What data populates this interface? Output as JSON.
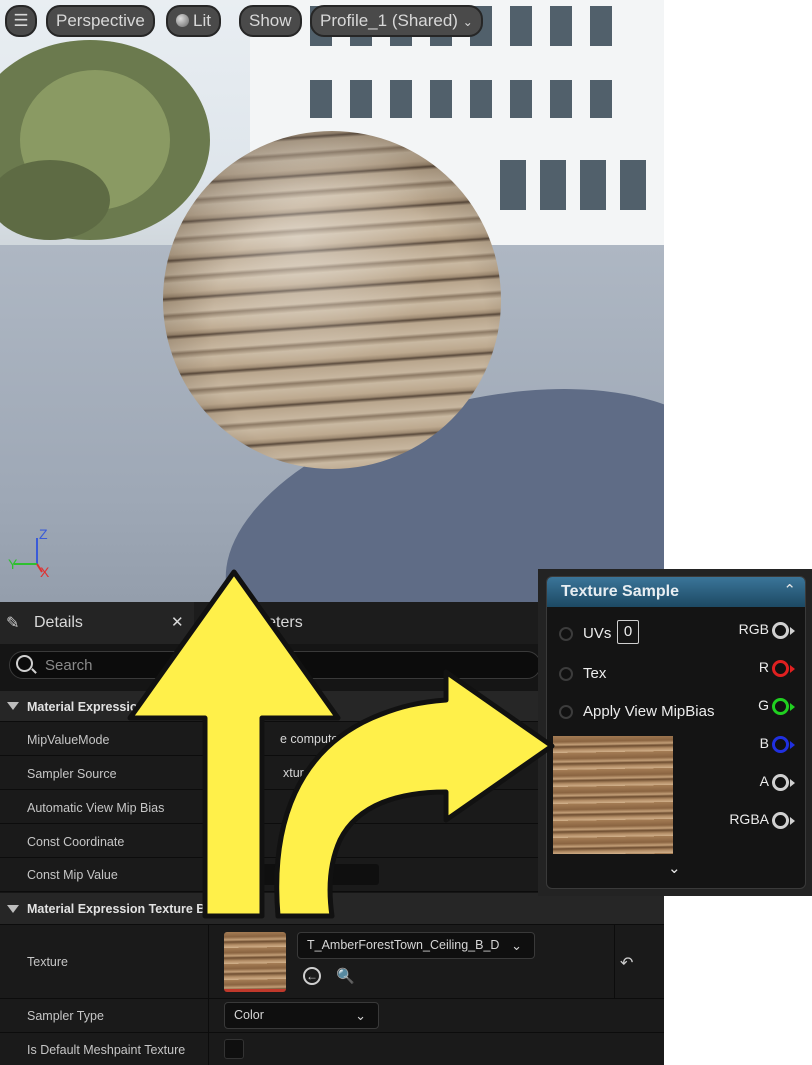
{
  "viewport": {
    "toolbar": {
      "perspective": "Perspective",
      "lit": "Lit",
      "show": "Show",
      "profile": "Profile_1 (Shared)"
    },
    "axis": {
      "z": "Z",
      "y": "Y",
      "x": "X"
    }
  },
  "details": {
    "tab_details": "Details",
    "tab_parameters": "Parameters",
    "search_placeholder": "Search",
    "categories": {
      "cat1": "Material Expression",
      "cat2": "Material Expression Texture Ba"
    },
    "props": {
      "mip_value_mode": {
        "label": "MipValueMode",
        "value": "e computed"
      },
      "sampler_source": {
        "label": "Sampler Source",
        "value": "xture a"
      },
      "auto_view_mip_bias": {
        "label": "Automatic View Mip Bias"
      },
      "const_coordinate": {
        "label": "Const Coordinate"
      },
      "const_mip_value": {
        "label": "Const Mip Value"
      },
      "texture": {
        "label": "Texture",
        "asset": "T_AmberForestTown_Ceiling_B_D"
      },
      "sampler_type": {
        "label": "Sampler Type",
        "value": "Color"
      },
      "default_meshpaint": {
        "label": "Is Default Meshpaint Texture"
      }
    }
  },
  "node": {
    "title": "Texture Sample",
    "inputs": [
      "UVs",
      "Tex",
      "Apply View MipBias"
    ],
    "uvs_value": "0",
    "outputs": [
      {
        "label": "RGB",
        "color": "#d0d0d0"
      },
      {
        "label": "R",
        "color": "#e02020"
      },
      {
        "label": "G",
        "color": "#20d020"
      },
      {
        "label": "B",
        "color": "#2030e0"
      },
      {
        "label": "A",
        "color": "#d0d0d0"
      },
      {
        "label": "RGBA",
        "color": "#d0d0d0"
      }
    ]
  },
  "annotation": {
    "arrow_color": "#fff04a"
  }
}
